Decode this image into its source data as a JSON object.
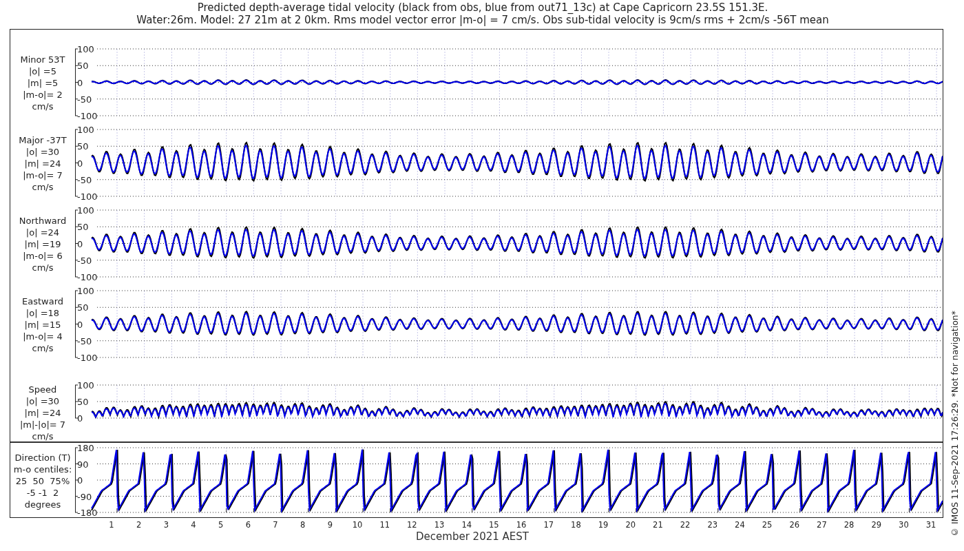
{
  "title": [
    "Predicted depth-average tidal velocity (black from obs, blue from out71_13c) at Cape Capricorn 23.5S 151.3E.",
    "Water:26m. Model: 27 21m at 2 0km. Rms model vector error |m-o| = 7 cm/s. Obs sub-tidal velocity is 9cm/s rms + 2cm/s -56T mean"
  ],
  "panels": [
    {
      "kind": "minor",
      "label_lines": [
        "Minor 53T",
        "|o| =5",
        "|m| =5",
        "|m-o|= 2",
        "cm/s"
      ],
      "yticks": [
        "100",
        "50",
        "0",
        "-50",
        "-100"
      ]
    },
    {
      "kind": "major",
      "label_lines": [
        "Major -37T",
        "|o| =30",
        "|m| =24",
        "|m-o|= 7",
        "cm/s"
      ],
      "yticks": [
        "100",
        "50",
        "0",
        "-50",
        "-100"
      ]
    },
    {
      "kind": "northward",
      "label_lines": [
        "Northward",
        "|o| =24",
        "|m| =19",
        "|m-o|= 6",
        "cm/s"
      ],
      "yticks": [
        "100",
        "50",
        "0",
        "-50",
        "-100"
      ]
    },
    {
      "kind": "eastward",
      "label_lines": [
        "Eastward",
        "|o| =18",
        "|m| =15",
        "|m-o|= 4",
        "cm/s"
      ],
      "yticks": [
        "100",
        "50",
        "0",
        "-50",
        "-100"
      ]
    },
    {
      "kind": "speed",
      "label_lines": [
        "Speed",
        "|o| =30",
        "|m| =24",
        "|m|-|o|= 7",
        "cm/s"
      ],
      "yticks": [
        "100",
        "50",
        "0"
      ]
    },
    {
      "kind": "direction",
      "label_lines": [
        "Direction (T)",
        "m-o centiles:",
        "25  50  75%",
        "-5 -1  2",
        "degrees"
      ],
      "yticks": [
        "180",
        "90",
        "0",
        "-90",
        "-180"
      ]
    }
  ],
  "xaxis": {
    "ticks": [
      "1",
      "2",
      "3",
      "4",
      "5",
      "6",
      "7",
      "8",
      "9",
      "10",
      "11",
      "12",
      "13",
      "14",
      "15",
      "16",
      "17",
      "18",
      "19",
      "20",
      "21",
      "22",
      "23",
      "24",
      "25",
      "26",
      "27",
      "28",
      "29",
      "30",
      "31"
    ],
    "label": "December 2021 AEST"
  },
  "caption": "© IMOS 11-Sep-2021 17:26:29. *Not for navigation*"
}
